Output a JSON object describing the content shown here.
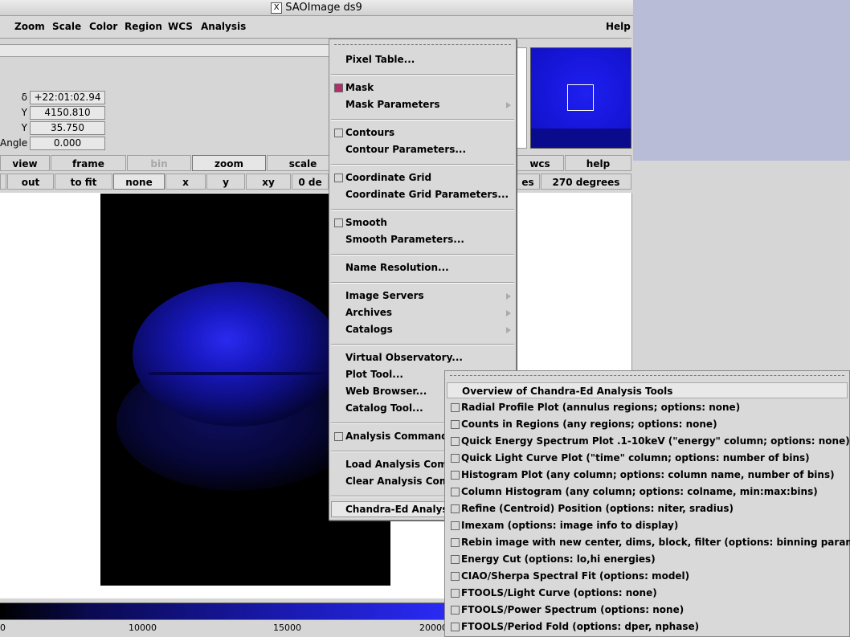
{
  "window": {
    "title": "SAOImage ds9",
    "x_glyph": "X"
  },
  "menubar": {
    "items": [
      "Zoom",
      "Scale",
      "Color",
      "Region",
      "WCS",
      "Analysis",
      "Help"
    ]
  },
  "info": {
    "rows": [
      {
        "label": "δ",
        "value": "+22:01:02.94"
      },
      {
        "label": "Y",
        "value": "4150.810"
      },
      {
        "label": "Y",
        "value": "35.750"
      },
      {
        "label": "Angle",
        "value": "0.000"
      }
    ]
  },
  "buttonbar1": {
    "view": "view",
    "frame": "frame",
    "bin": "bin",
    "zoom": "zoom",
    "scale": "scale",
    "wcs": "wcs",
    "help": "help"
  },
  "buttonbar2": {
    "out": "out",
    "tofit": "to fit",
    "none": "none",
    "x": "x",
    "y": "y",
    "xy": "xy",
    "deg0": "0 de",
    "es": "es",
    "deg270": "270 degrees"
  },
  "colorbar": {
    "ticks": [
      "0",
      "10000",
      "15000",
      "20000"
    ]
  },
  "analysis_menu": {
    "pixel_table": "Pixel Table...",
    "mask": "Mask",
    "mask_checked": true,
    "mask_parameters": "Mask Parameters",
    "contours": "Contours",
    "contour_parameters": "Contour Parameters...",
    "coordinate_grid": "Coordinate Grid",
    "coordinate_grid_parameters": "Coordinate Grid Parameters...",
    "smooth": "Smooth",
    "smooth_parameters": "Smooth Parameters...",
    "name_resolution": "Name Resolution...",
    "image_servers": "Image Servers",
    "archives": "Archives",
    "catalogs": "Catalogs",
    "virtual_observatory": "Virtual Observatory...",
    "plot_tool": "Plot Tool...",
    "web_browser": "Web Browser...",
    "catalog_tool": "Catalog Tool...",
    "analysis_command_log": "Analysis Command L",
    "load_analysis_commands": "Load Analysis Comm",
    "clear_analysis_commands": "Clear Analysis Comm",
    "chandra_ed_analysis": "Chandra-Ed Analysis"
  },
  "chandra_menu": {
    "overview": "Overview of Chandra-Ed Analysis Tools",
    "items": [
      "Radial Profile Plot (annulus regions; options: none)",
      "Counts in Regions (any regions; options: none)",
      "Quick Energy Spectrum Plot .1-10keV (\"energy\" column; options: none)",
      "Quick Light Curve Plot (\"time\" column; options: number of bins)",
      "Histogram Plot (any column; options: column name, number of bins)",
      "Column Histogram (any column; options: colname, min:max:bins)",
      "Refine (Centroid) Position (options: niter, sradius)",
      "Imexam (options: image info to display)",
      "Rebin image with new center, dims, block, filter (options: binning parameters)",
      "Energy Cut (options: lo,hi energies)",
      "CIAO/Sherpa Spectral Fit (options: model)",
      "FTOOLS/Light Curve (options: none)",
      "FTOOLS/Power Spectrum (options: none)",
      "FTOOLS/Period Fold (options: dper, nphase)"
    ]
  }
}
